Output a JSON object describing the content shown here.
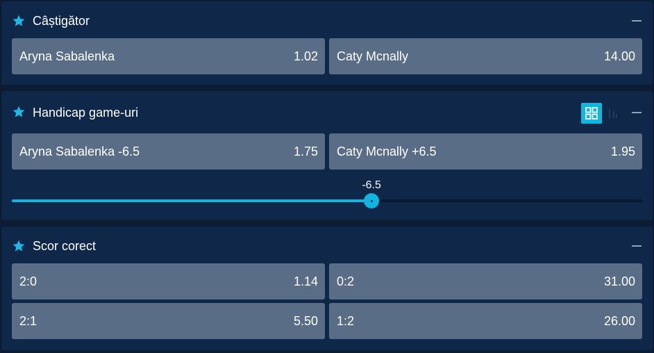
{
  "colors": {
    "background": "#0b1c33",
    "panel": "#0f284a",
    "odd_button": "#5a6d86",
    "accent": "#10b4e0"
  },
  "markets": [
    {
      "title": "Câștigător",
      "icon": "star-icon",
      "outcomes": [
        {
          "label": "Aryna Sabalenka",
          "odd": "1.02"
        },
        {
          "label": "Caty Mcnally",
          "odd": "14.00"
        }
      ]
    },
    {
      "title": "Handicap game-uri",
      "icon": "star-icon",
      "view_icons": [
        "grid-view-icon",
        "list-view-icon"
      ],
      "outcomes": [
        {
          "label": "Aryna Sabalenka -6.5",
          "odd": "1.75"
        },
        {
          "label": "Caty Mcnally +6.5",
          "odd": "1.95"
        }
      ],
      "slider": {
        "value_label": "-6.5",
        "position_fraction": 0.57
      }
    },
    {
      "title": "Scor corect",
      "icon": "star-icon",
      "outcomes": [
        {
          "label": "2:0",
          "odd": "1.14"
        },
        {
          "label": "0:2",
          "odd": "31.00"
        },
        {
          "label": "2:1",
          "odd": "5.50"
        },
        {
          "label": "1:2",
          "odd": "26.00"
        }
      ]
    }
  ]
}
